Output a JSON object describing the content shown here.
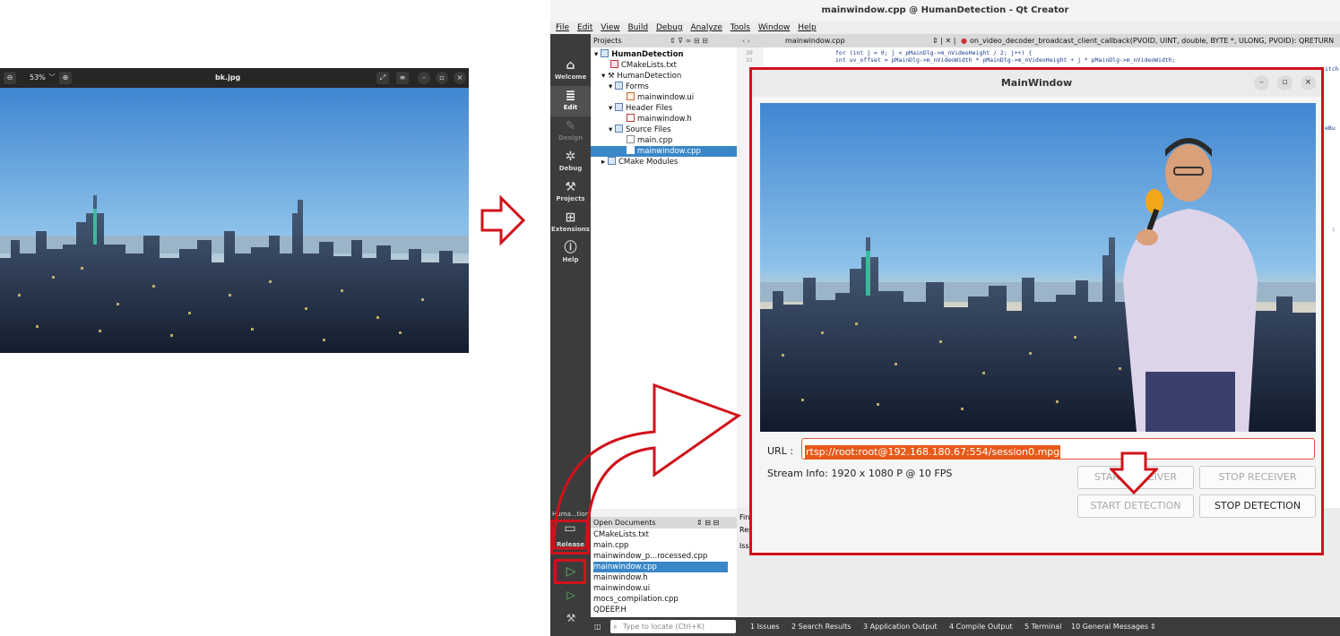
{
  "viewer": {
    "zoom": "53%",
    "filename": "bk.jpg"
  },
  "qt": {
    "window_title": "mainwindow.cpp @ HumanDetection - Qt Creator",
    "menu": [
      "File",
      "Edit",
      "View",
      "Build",
      "Debug",
      "Analyze",
      "Tools",
      "Window",
      "Help"
    ],
    "modes": [
      {
        "label": "Welcome",
        "icon": "home-icon"
      },
      {
        "label": "Edit",
        "icon": "document-icon"
      },
      {
        "label": "Design",
        "icon": "pen-icon"
      },
      {
        "label": "Debug",
        "icon": "bug-icon"
      },
      {
        "label": "Projects",
        "icon": "wrench-icon"
      },
      {
        "label": "Extensions",
        "icon": "grid-plus-icon"
      },
      {
        "label": "Help",
        "icon": "help-icon"
      }
    ],
    "kit": {
      "name": "Huma...tion",
      "build": "Release"
    },
    "projects_header": "Projects",
    "tree": [
      {
        "label": "HumanDetection",
        "bold": true
      },
      {
        "label": "CMakeLists.txt"
      },
      {
        "label": "HumanDetection"
      },
      {
        "label": "Forms"
      },
      {
        "label": "mainwindow.ui"
      },
      {
        "label": "Header Files"
      },
      {
        "label": "mainwindow.h"
      },
      {
        "label": "Source Files"
      },
      {
        "label": "main.cpp"
      },
      {
        "label": "mainwindow.cpp",
        "selected": true
      },
      {
        "label": "CMake Modules"
      }
    ],
    "open_documents_header": "Open Documents",
    "open_documents": [
      "CMakeLists.txt",
      "main.cpp",
      "mainwindow_p...rocessed.cpp",
      "mainwindow.cpp",
      "mainwindow.h",
      "mainwindow.ui",
      "mocs_compilation.cpp",
      "QDEEP.H"
    ],
    "editor_tab": "mainwindow.cpp",
    "function_crumb": "on_video_decoder_broadcast_client_callback(PVOID, UINT, double, BYTE *, ULONG, PVOID): QRETURN",
    "code_lines": [
      "for (int j = 0; j < pMainDlg->m_nVideoHeight / 2; j++) {",
      "    int uv_offset = pMainDlg->m_nVideoWidth * pMainDlg->m_nVideoHeight + j * pMainDlg->m_nVideoWidth;"
    ],
    "line_numbers": [
      "30",
      "31"
    ],
    "code_right_fragments": [
      "itch",
      "eBu",
      ";"
    ],
    "bottom_fragments": [
      "Fin",
      "Rep",
      "Issu"
    ],
    "locator_placeholder": "Type to locate (Ctrl+K)",
    "status_tabs": [
      "1 Issues",
      "2 Search Results",
      "3 Application Output",
      "4 Compile Output",
      "5 Terminal",
      "10 General Messages"
    ]
  },
  "mainwindow": {
    "title": "MainWindow",
    "url_label": "URL :",
    "url_value": "rtsp://root:root@192.168.180.67:554/session0.mpg",
    "stream_info": "Stream Info: 1920 x 1080 P  @ 10 FPS",
    "buttons": {
      "start_receiver": "START RECEIVER",
      "stop_receiver": "STOP RECEIVER",
      "start_detection": "START DETECTION",
      "stop_detection": "STOP DETECTION"
    }
  },
  "colors": {
    "callout_red": "#d0121b",
    "qt_dark": "#3c3c3c",
    "selection_blue": "#3a87c8",
    "url_highlight": "#e85a1a"
  }
}
